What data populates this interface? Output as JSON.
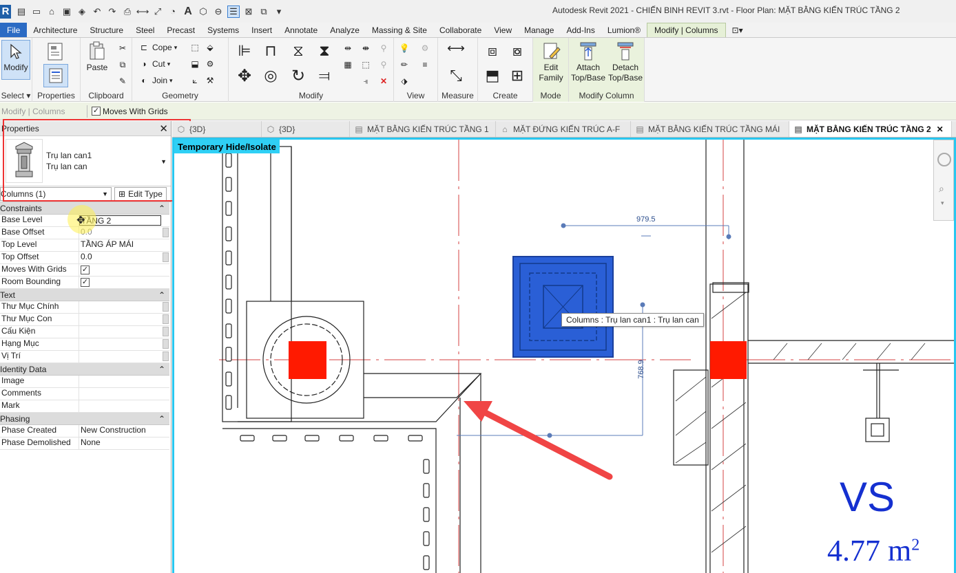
{
  "window": {
    "title": "Autodesk Revit 2021 - CHIẾN BINH REVIT 3.rvt - Floor Plan: MẶT BẰNG KIẾN TRÚC TẦNG 2"
  },
  "ribbon_tabs": [
    {
      "label": "File"
    },
    {
      "label": "Architecture"
    },
    {
      "label": "Structure"
    },
    {
      "label": "Steel"
    },
    {
      "label": "Precast"
    },
    {
      "label": "Systems"
    },
    {
      "label": "Insert"
    },
    {
      "label": "Annotate"
    },
    {
      "label": "Analyze"
    },
    {
      "label": "Massing & Site"
    },
    {
      "label": "Collaborate"
    },
    {
      "label": "View"
    },
    {
      "label": "Manage"
    },
    {
      "label": "Add-Ins"
    },
    {
      "label": "Lumion®"
    },
    {
      "label": "Modify | Columns"
    }
  ],
  "ribbon": {
    "select": {
      "modify_label": "Modify",
      "panel_label": "Select ▾"
    },
    "properties": {
      "panel_label": "Properties"
    },
    "clipboard": {
      "paste_label": "Paste",
      "panel_label": "Clipboard"
    },
    "geometry": {
      "cope_label": "Cope",
      "cut_label": "Cut",
      "join_label": "Join",
      "panel_label": "Geometry"
    },
    "modify": {
      "panel_label": "Modify"
    },
    "view": {
      "panel_label": "View"
    },
    "measure": {
      "panel_label": "Measure"
    },
    "create": {
      "panel_label": "Create"
    },
    "mode": {
      "edit_family_label_1": "Edit",
      "edit_family_label_2": "Family",
      "panel_label": "Mode"
    },
    "modify_column": {
      "attach_label_1": "Attach",
      "attach_label_2": "Top/Base",
      "detach_label_1": "Detach",
      "detach_label_2": "Top/Base",
      "panel_label": "Modify Column"
    }
  },
  "options_bar": {
    "context": "Modify | Columns",
    "moves_with_grids_label": "Moves With Grids",
    "moves_with_grids_checked": true
  },
  "properties": {
    "title": "Properties",
    "type_name": "Trụ lan can1",
    "family_name": "Trụ lan can",
    "filter": "Columns (1)",
    "edit_type_label": "Edit Type",
    "groups": {
      "constraints": "Constraints",
      "text": "Text",
      "identity": "Identity Data",
      "phasing": "Phasing"
    },
    "rows": {
      "base_level": {
        "k": "Base Level",
        "v": "TẦNG 2"
      },
      "base_offset": {
        "k": "Base Offset",
        "v": "0.0"
      },
      "top_level": {
        "k": "Top Level",
        "v": "TẦNG ÁP MÁI"
      },
      "top_offset": {
        "k": "Top Offset",
        "v": "0.0"
      },
      "moves_with_grids": {
        "k": "Moves With Grids",
        "checked": true
      },
      "room_bounding": {
        "k": "Room Bounding",
        "checked": true
      },
      "thu_muc_chinh": {
        "k": "Thư Mục Chính",
        "v": ""
      },
      "thu_muc_con": {
        "k": "Thư Mục Con",
        "v": ""
      },
      "cau_kien": {
        "k": "Cấu Kiện",
        "v": ""
      },
      "hang_muc": {
        "k": "Hạng Mục",
        "v": ""
      },
      "vi_tri": {
        "k": "Vị Trí",
        "v": ""
      },
      "image": {
        "k": "Image",
        "v": ""
      },
      "comments": {
        "k": "Comments",
        "v": ""
      },
      "mark": {
        "k": "Mark",
        "v": ""
      },
      "phase_created": {
        "k": "Phase Created",
        "v": "New Construction"
      },
      "phase_demolished": {
        "k": "Phase Demolished",
        "v": "None"
      }
    }
  },
  "view_tabs": [
    {
      "label": "{3D}",
      "active": false
    },
    {
      "label": "{3D}",
      "active": false
    },
    {
      "label": "MẶT BẰNG KIẾN TRÚC TẦNG 1",
      "active": false
    },
    {
      "label": "MẶT ĐỨNG KIẾN TRÚC A-F",
      "active": false
    },
    {
      "label": "MẶT BẰNG KIẾN TRÚC TẦNG MÁI",
      "active": false
    },
    {
      "label": "MẶT BẰNG KIẾN TRÚC TẦNG 2",
      "active": true
    }
  ],
  "drawing": {
    "banner": "Temporary Hide/Isolate",
    "tooltip": "Columns : Trụ lan can1 : Trụ lan can",
    "dim_horizontal": "979.5",
    "dim_vertical": "768.9",
    "room_name": "VS",
    "room_area": "4.77 m",
    "room_area_unit_sup": "2",
    "colors": {
      "selection": "#2a5fd6",
      "room_text": "#1530d0",
      "grid_line": "#d64040",
      "fill_red": "#ff1a00",
      "arrow": "#f04545",
      "view_border": "#28c7f0"
    }
  }
}
